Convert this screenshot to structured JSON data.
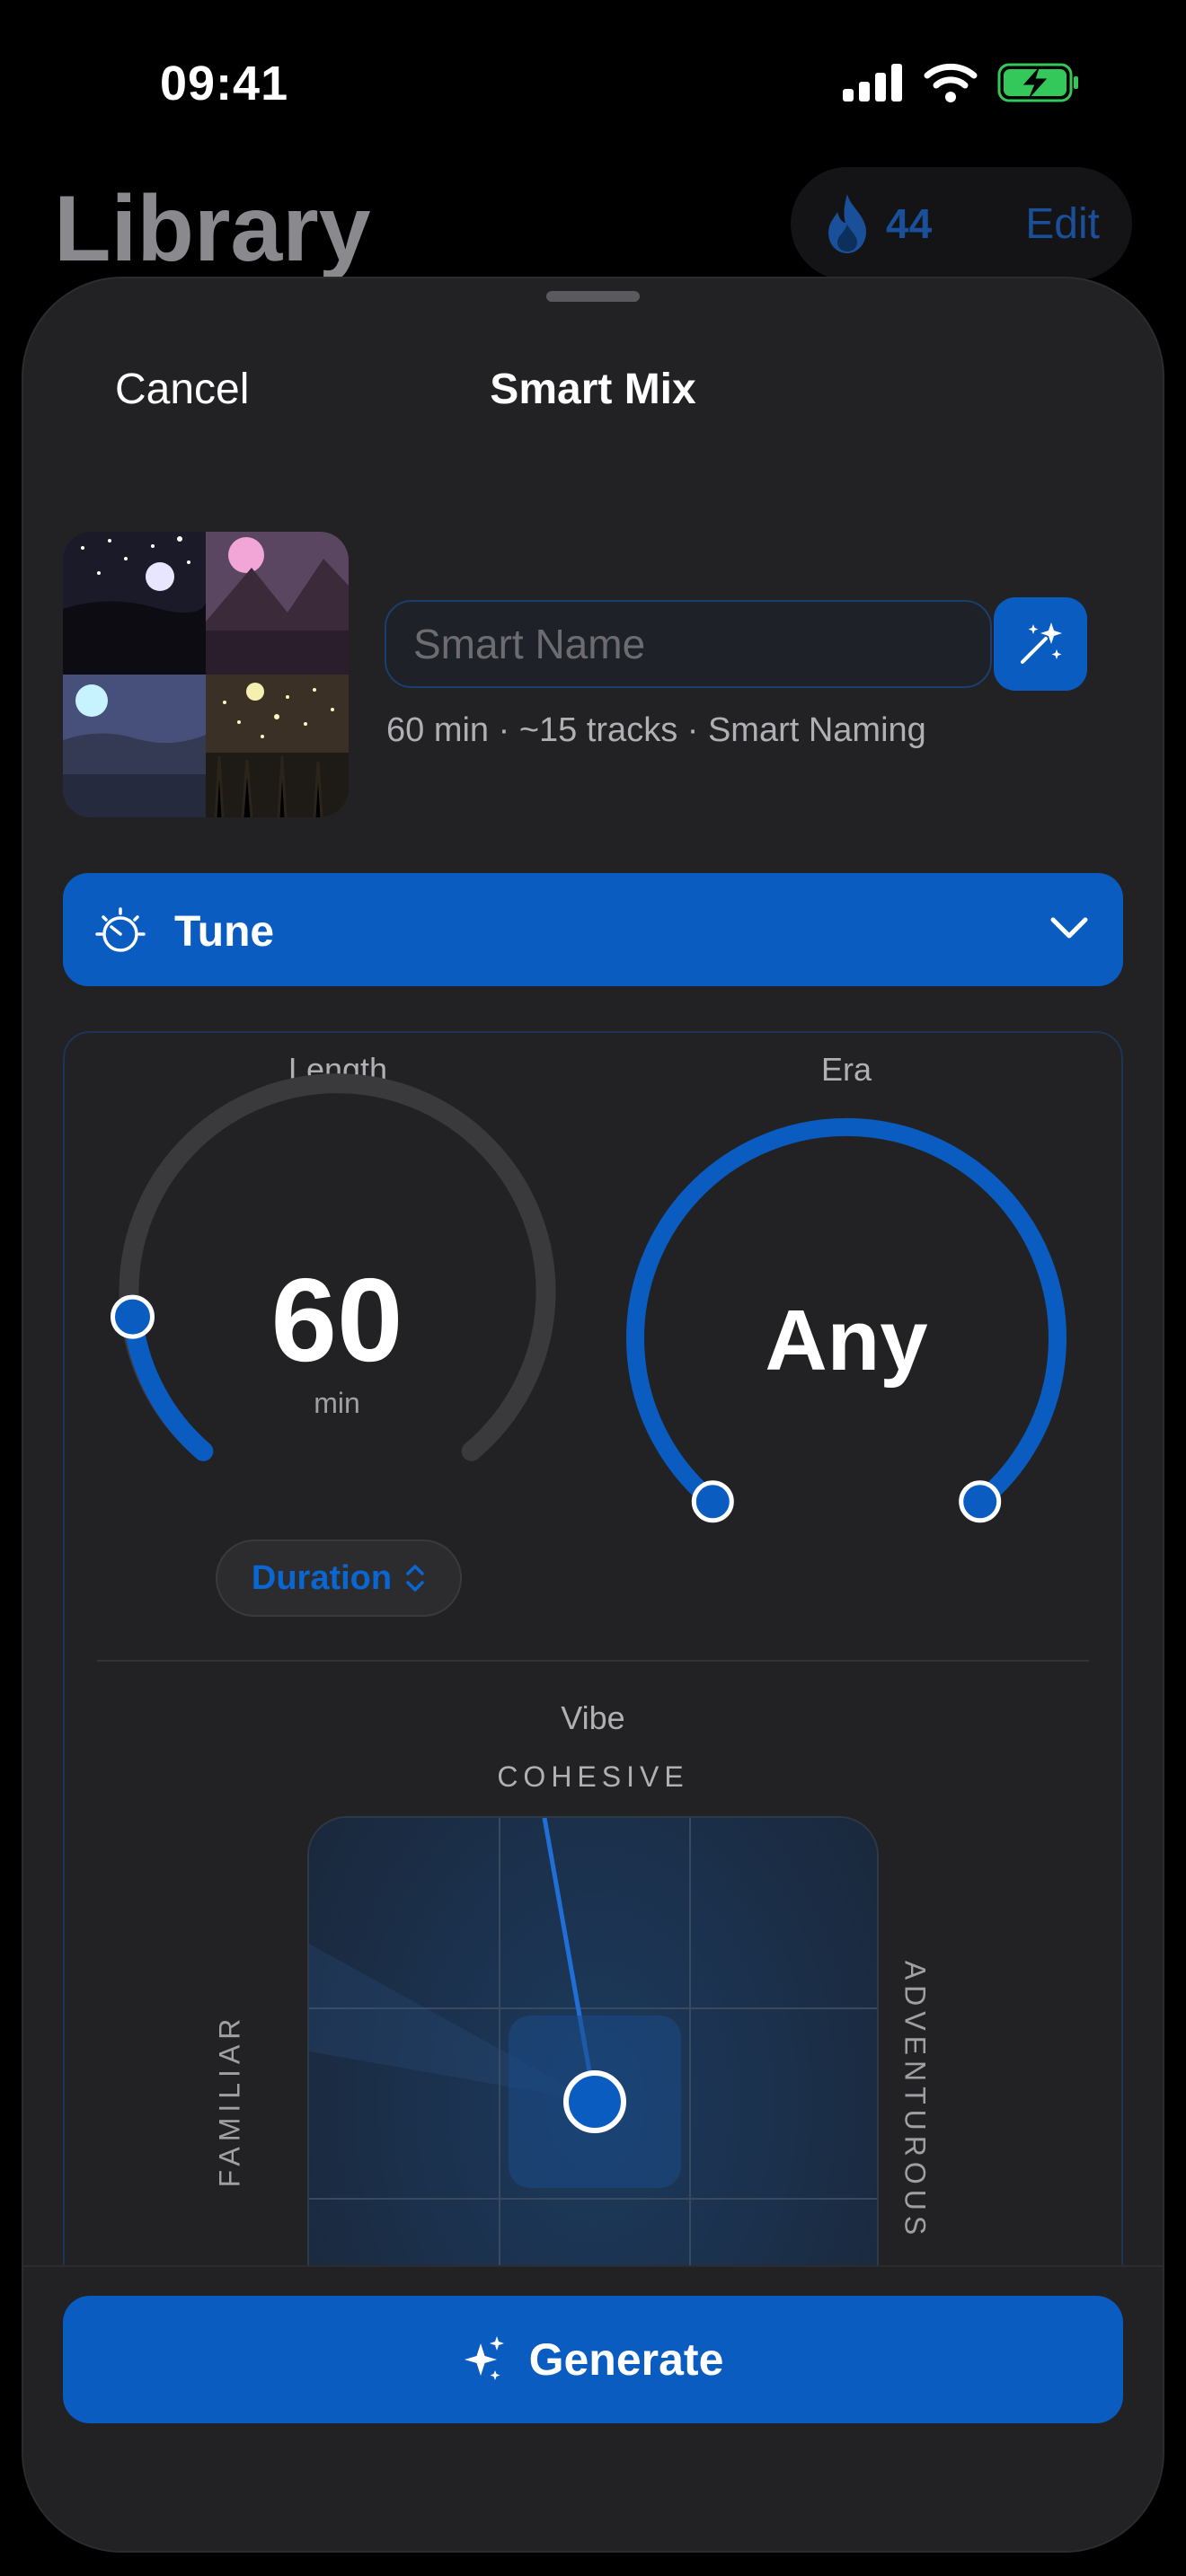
{
  "status_bar": {
    "time": "09:41",
    "battery_color": "#34c759"
  },
  "background": {
    "title": "Library",
    "streak_count": "44",
    "edit_label": "Edit"
  },
  "sheet": {
    "cancel_label": "Cancel",
    "title": "Smart Mix",
    "name_field": {
      "value": "",
      "placeholder": "Smart Name"
    },
    "meta": "60 min · ~15 tracks · Smart Naming",
    "tune": {
      "label": "Tune",
      "expanded": true
    },
    "length_dial": {
      "label": "Length",
      "value": "60",
      "unit": "min",
      "fill_fraction": 0.22
    },
    "era_dial": {
      "label": "Era",
      "value": "Any",
      "range": "full"
    },
    "duration_picker": {
      "label": "Duration"
    },
    "vibe": {
      "label": "Vibe",
      "axis_top": "COHESIVE",
      "axis_left": "FAMILIAR",
      "axis_right": "ADVENTUROUS"
    },
    "generate_label": "Generate"
  },
  "colors": {
    "accent": "#0a5cc0",
    "sheet_bg": "#222224",
    "page_bg": "#000000"
  }
}
